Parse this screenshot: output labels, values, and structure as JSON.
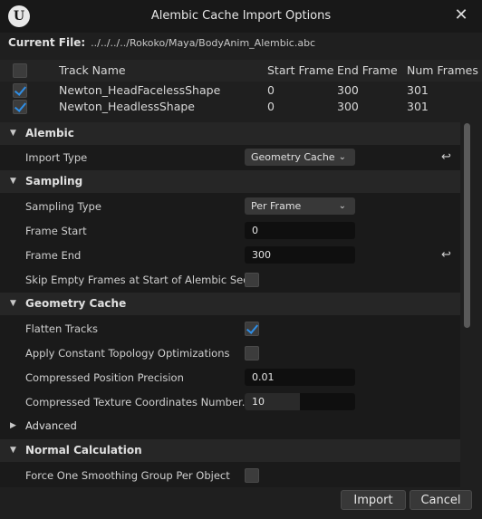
{
  "window": {
    "title": "Alembic Cache Import Options",
    "logo": "U"
  },
  "current_file": {
    "label": "Current File:",
    "path": "../../../../Rokoko/Maya/BodyAnim_Alembic.abc"
  },
  "tracks": {
    "headers": {
      "name": "Track Name",
      "start": "Start Frame",
      "end": "End Frame",
      "num": "Num Frames"
    },
    "rows": [
      {
        "name": "Newton_HeadFacelessShape",
        "start": "0",
        "end": "300",
        "num": "301",
        "checked": true
      },
      {
        "name": "Newton_HeadlessShape",
        "start": "0",
        "end": "300",
        "num": "301",
        "checked": true
      }
    ]
  },
  "alembic": {
    "title": "Alembic",
    "import_type_label": "Import Type",
    "import_type_value": "Geometry Cache"
  },
  "sampling": {
    "title": "Sampling",
    "sampling_type_label": "Sampling Type",
    "sampling_type_value": "Per Frame",
    "frame_start_label": "Frame Start",
    "frame_start_value": "0",
    "frame_end_label": "Frame End",
    "frame_end_value": "300",
    "skip_empty_label": "Skip Empty Frames at Start of Alembic Seq...",
    "skip_empty_checked": false
  },
  "geometry_cache": {
    "title": "Geometry Cache",
    "flatten_label": "Flatten Tracks",
    "flatten_checked": true,
    "topology_label": "Apply Constant Topology Optimizations",
    "topology_checked": false,
    "position_precision_label": "Compressed Position Precision",
    "position_precision_value": "0.01",
    "texcoord_label": "Compressed Texture Coordinates Number...",
    "texcoord_value": "10",
    "texcoord_slider_fraction": 0.5
  },
  "advanced": {
    "title": "Advanced"
  },
  "normal_calculation": {
    "title": "Normal Calculation",
    "smoothing_label": "Force One Smoothing Group Per Object",
    "smoothing_checked": false
  },
  "buttons": {
    "import": "Import",
    "cancel": "Cancel"
  },
  "icons": {
    "close": "close-icon",
    "reset": "reset-arrow-icon",
    "expanded": "triangle-down-icon",
    "collapsed": "triangle-right-icon",
    "dropdown": "chevron-down-icon"
  },
  "colors": {
    "accent": "#2f8ee6",
    "background": "#1f1f1f"
  }
}
